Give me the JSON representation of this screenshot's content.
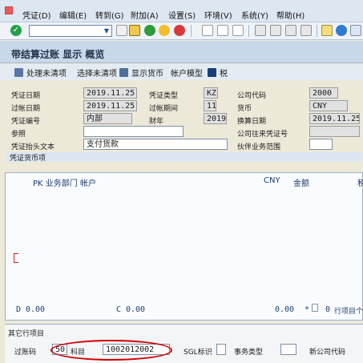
{
  "menu": [
    "凭证(D)",
    "编辑(E)",
    "转到(G)",
    "附加(A)",
    "设置(S)",
    "环境(V)",
    "系统(Y)",
    "帮助(H)"
  ],
  "page_title": "带结算过账 显示 概览",
  "toolbar": {
    "icons": [
      "check-icon",
      "command-field",
      "back-icon",
      "save-icon",
      "green-arrow-icon",
      "exit-icon",
      "cancel-icon",
      "print-icon",
      "find-icon",
      "find-next-icon",
      "first-page-icon",
      "prev-page-icon",
      "next-page-icon",
      "last-page-icon",
      "layout-icon",
      "help-icon",
      "monitor-icon"
    ]
  },
  "app_toolbar": {
    "open_items": "处理未清项",
    "choose_open_items": "选择未清项",
    "show_currency": "显示货币",
    "account_model": "帐户模型",
    "tax": "税"
  },
  "header": {
    "doc_date_label": "凭证日期",
    "doc_date": "2019.11.25",
    "doc_type_label": "凭证类型",
    "doc_type": "KZ",
    "company_code_label": "公司代码",
    "company_code": "2000",
    "posting_date_label": "过帐日期",
    "posting_date": "2019.11.25",
    "posting_period_label": "过帐期间",
    "posting_period": "11",
    "currency_label": "货币",
    "currency": "CNY",
    "doc_number_label": "凭证编号",
    "doc_number": "内部",
    "fiscal_year_label": "财年",
    "fiscal_year": "2019",
    "translation_date_label": "换算日期",
    "translation_date": "2019.11.25",
    "reference_label": "参照",
    "intercompany_label": "公司往来凭证号",
    "doc_header_text_label": "凭证抬头文本",
    "doc_header_text": "支付货款",
    "trading_partner_label": "伙伴业务范围"
  },
  "grid": {
    "title": "凭证货币项",
    "header": "PK 业务部门 帐户",
    "currency_header": "CNY",
    "amount_header": "金额",
    "tax_header": "税",
    "debit_label": "D",
    "debit": "0.00",
    "credit_label": "C",
    "credit": "0.00",
    "balance": "0.00",
    "balance_mark": "*",
    "line_items": "0",
    "line_items_label": "行项目个数"
  },
  "next_item": {
    "title": "其它行项目",
    "posting_key_label": "过账码",
    "posting_key": "50",
    "account_label": "科目",
    "account": "1002012002",
    "sgl_label": "SGL标识",
    "transaction_type_label": "事务类型",
    "new_company_code_label": "新公司代码"
  }
}
